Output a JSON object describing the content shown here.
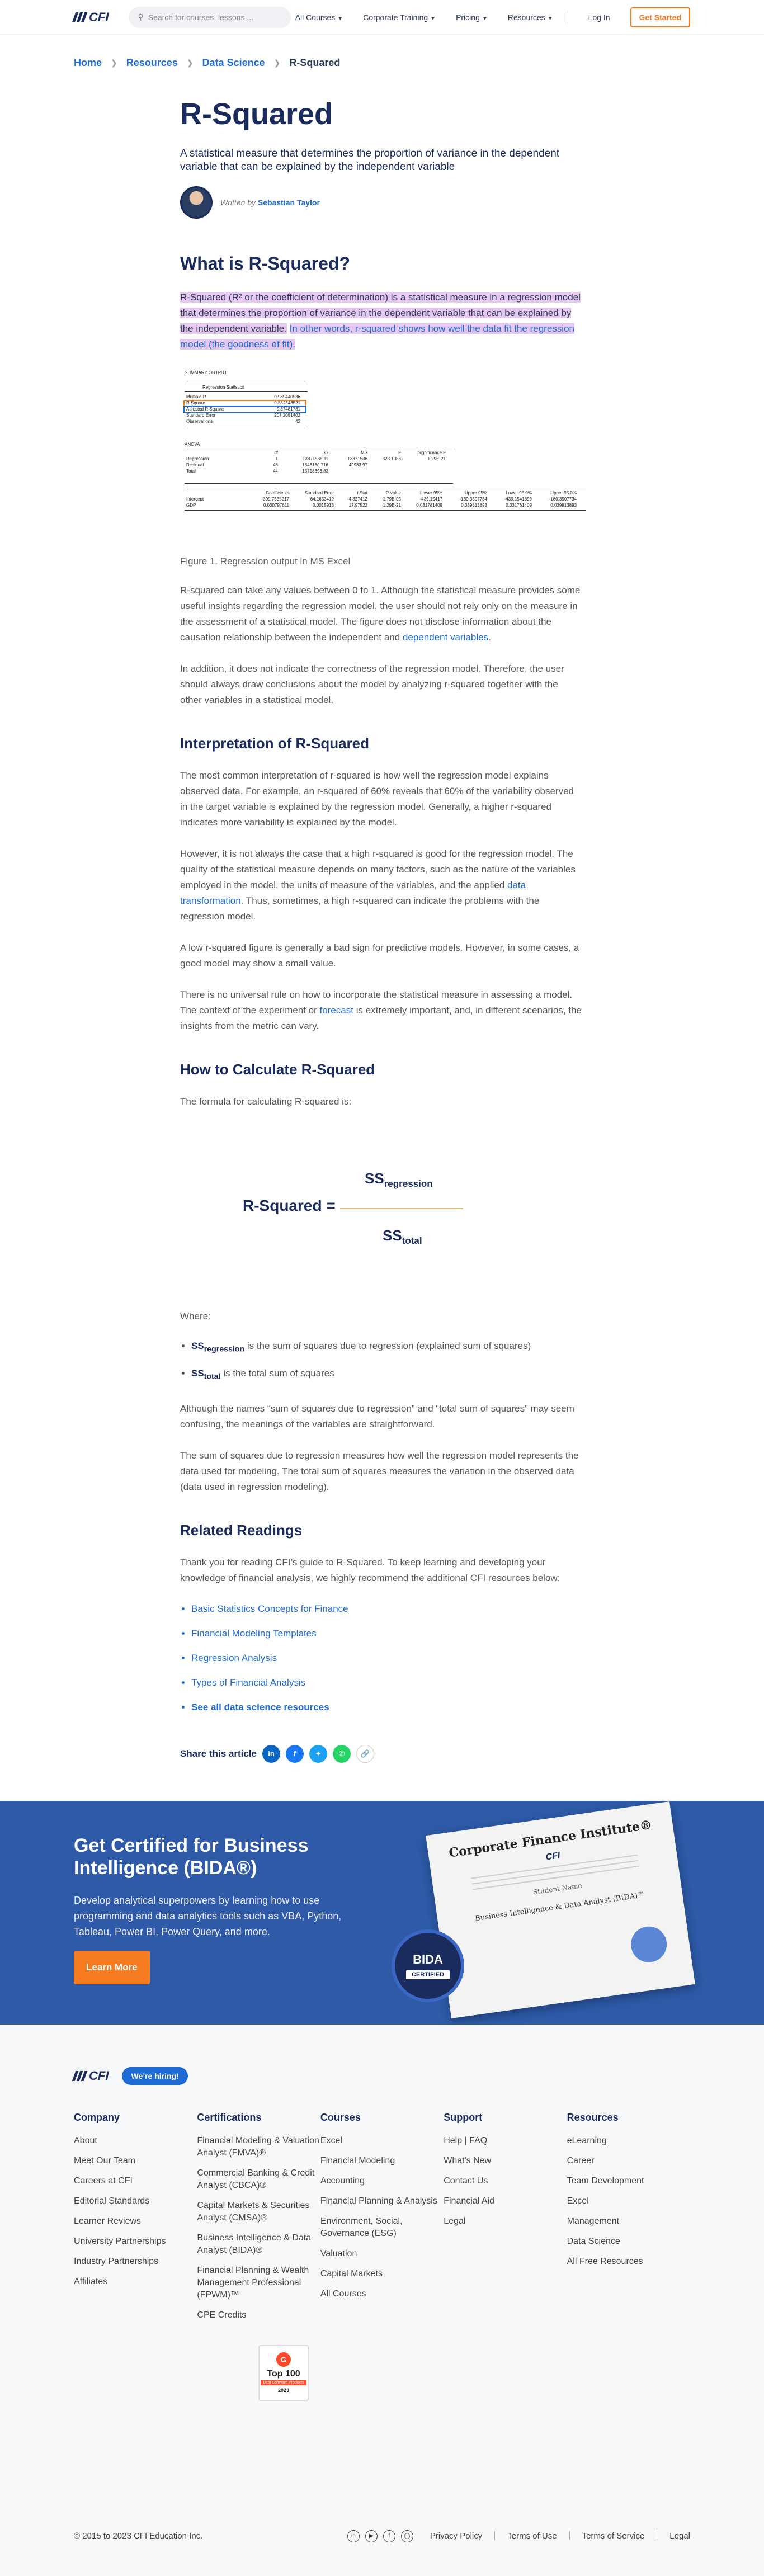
{
  "header": {
    "logo": "CFI",
    "search_placeholder": "Search for courses, lessons ...",
    "nav": [
      "All Courses",
      "Corporate Training",
      "Pricing",
      "Resources"
    ],
    "login": "Log In",
    "get_started": "Get Started"
  },
  "breadcrumb": [
    "Home",
    "Resources",
    "Data Science",
    "R-Squared"
  ],
  "article": {
    "title": "R-Squared",
    "lede": "A statistical measure that determines the proportion of variance in the dependent variable that can be explained by the independent variable",
    "written_by": "Written by",
    "author": "Sebastian Taylor",
    "h_what": "What is R-Squared?",
    "p_what_hl": "R-Squared (R² or the coefficient of determination) is a statistical measure in a regression model that determines the proportion of variance in the dependent variable that can be explained by the independent variable.",
    "p_what_hl2": "In other words, r-squared shows how well the data fit the regression model (the goodness of fit).",
    "figcap": "Figure 1. Regression output in MS Excel",
    "p1": "R-squared can take any values between 0 to 1. Although the statistical measure provides some useful insights regarding the regression model, the user should not rely only on the measure in the assessment of a statistical model. The figure does not disclose information about the causation relationship between the independent and",
    "p1_link": "dependent variables",
    "p2": "In addition, it does not indicate the correctness of the regression model. Therefore, the user should always draw conclusions about the model by analyzing r-squared together with the other variables in a statistical model.",
    "h_interp": "Interpretation of R-Squared",
    "p3": "The most common interpretation of r-squared is how well the regression model explains observed data. For example, an r-squared of 60% reveals that 60% of the variability observed in the target variable is explained by the regression model. Generally, a higher r-squared indicates more variability is explained by the model.",
    "p4a": "However, it is not always the case that a high r-squared is good for the regression model. The quality of the statistical measure depends on many factors, such as the nature of the variables employed in the model, the units of measure of the variables, and the applied",
    "p4_link": "data transformation",
    "p4b": ". Thus, sometimes, a high r-squared can indicate the problems with the regression model.",
    "p5": "A low r-squared figure is generally a bad sign for predictive models. However, in some cases, a good model may show a small value.",
    "p6a": "There is no universal rule on how to incorporate the statistical measure in assessing a model. The context of the experiment or",
    "p6_link": "forecast",
    "p6b": "is extremely important, and, in different scenarios, the insights from the metric can vary.",
    "h_calc": "How to Calculate R-Squared",
    "p7": "The formula for calculating R-squared is:",
    "formula_lhs": "R-Squared =",
    "formula_num": "SS",
    "formula_num_sub": "regression",
    "formula_den": "SS",
    "formula_den_sub": "total",
    "where": "Where:",
    "b1_sub": "regression",
    "b1": "is the sum of squares due to regression (explained sum of squares)",
    "b2_sub": "total",
    "b2": "is the total sum of squares",
    "p8": "Although the names “sum of squares due to regression” and “total sum of squares” may seem confusing, the meanings of the variables are straightforward.",
    "p9": "The sum of squares due to regression measures how well the regression model represents the data used for modeling. The total sum of squares measures the variation in the observed data (data used in regression modeling).",
    "h_related": "Related Readings",
    "p10": "Thank you for reading CFI’s guide to R-Squared. To keep learning and developing your knowledge of financial analysis, we highly recommend the additional CFI resources below:",
    "related": [
      "Basic Statistics Concepts for Finance",
      "Financial Modeling Templates",
      "Regression Analysis",
      "Types of Financial Analysis"
    ],
    "see_all": "See all data science resources",
    "share": "Share this article"
  },
  "excel": {
    "summary": "SUMMARY OUTPUT",
    "reg_stats": "Regression Statistics",
    "stats": [
      [
        "Multiple R",
        "0.939440536"
      ],
      [
        "R Square",
        "0.882548521"
      ],
      [
        "Adjusted R Square",
        "0.87481781"
      ],
      [
        "Standard Error",
        "207.2051402"
      ],
      [
        "Observations",
        "42"
      ]
    ],
    "anova": "ANOVA",
    "anova_head": [
      "",
      "df",
      "SS",
      "MS",
      "F",
      "Significance F"
    ],
    "anova_rows": [
      [
        "Regression",
        "1",
        "13871536.11",
        "13871536",
        "323.1086",
        "1.29E-21"
      ],
      [
        "Residual",
        "43",
        "1846160.716",
        "42933.97",
        "",
        ""
      ],
      [
        "Total",
        "44",
        "15718696.83",
        "",
        "",
        ""
      ]
    ],
    "coef_head": [
      "",
      "Coefficients",
      "Standard Error",
      "t Stat",
      "P-value",
      "Lower 95%",
      "Upper 95%",
      "Lower 95.0%",
      "Upper 95.0%"
    ],
    "coef_rows": [
      [
        "Intercept",
        "-309.7535217",
        "64.1653419",
        "-4.827412",
        "1.79E-05",
        "-439.15417",
        "-180.3507734",
        "-439.1541699",
        "-180.3507734"
      ],
      [
        "GDP",
        "0.030797611",
        "0.0015913",
        "17.97522",
        "1.29E-21",
        "0.031781409",
        "0.039813893",
        "0.031781409",
        "0.039813893"
      ]
    ]
  },
  "promo": {
    "title": "Get Certified for  Business Intelligence (BIDA®)",
    "text": "Develop analytical superpowers by learning how to use programming and data analytics tools such as VBA, Python, Tableau, Power BI, Power Query, and more.",
    "cta": "Learn More",
    "cert_title": "Corporate Finance Institute®",
    "cert_name": "Student Name",
    "cert_desig": "Business Intelligence & Data Analyst (BIDA)™",
    "badge": "BIDA",
    "badge_sub": "CERTIFIED"
  },
  "footer": {
    "hiring": "We’re hiring!",
    "cols": [
      {
        "title": "Company",
        "items": [
          "About",
          "Meet Our Team",
          "Careers at CFI",
          "Editorial Standards",
          "Learner Reviews",
          "University Partnerships",
          "Industry Partnerships",
          "Affiliates"
        ]
      },
      {
        "title": "Certifications",
        "items": [
          "Financial Modeling & Valuation Analyst (FMVA)®",
          "Commercial Banking & Credit Analyst (CBCA)®",
          "Capital Markets & Securities Analyst (CMSA)®",
          "Business Intelligence & Data Analyst (BIDA)®",
          "Financial Planning & Wealth Management Professional (FPWM)™",
          "CPE Credits"
        ]
      },
      {
        "title": "Courses",
        "items": [
          "Excel",
          "Financial Modeling",
          "Accounting",
          "Financial Planning & Analysis",
          "Environment, Social, Governance (ESG)",
          "Valuation",
          "Capital Markets",
          "All Courses"
        ]
      },
      {
        "title": "Support",
        "items": [
          "Help | FAQ",
          "What's New",
          "Contact Us",
          "Financial Aid",
          "Legal"
        ]
      },
      {
        "title": "Resources",
        "items": [
          "eLearning",
          "Career",
          "Team Development",
          "Excel",
          "Management",
          "Data Science",
          "All Free Resources"
        ]
      }
    ],
    "g2_top": "Top 100",
    "g2_sub": "Best Software Products",
    "g2_year": "2023",
    "copyright": "© 2015 to 2023 CFI Education Inc.",
    "links": [
      "Privacy Policy",
      "Terms of Use",
      "Terms of Service",
      "Legal"
    ]
  },
  "colors": {
    "navy": "#1a2b5e",
    "link": "#1e6bd6",
    "orange": "#f47b20",
    "promo": "#2e5aa8",
    "highlight": "#e6c8ef"
  }
}
